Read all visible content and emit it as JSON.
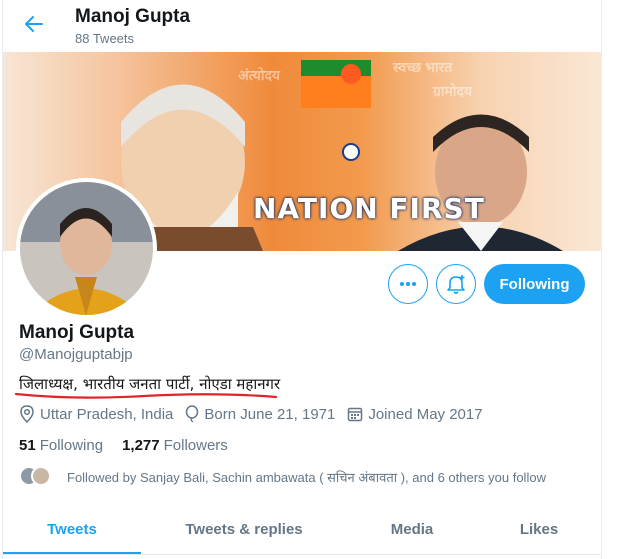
{
  "header": {
    "name": "Manoj Gupta",
    "tweet_count": "88 Tweets"
  },
  "banner": {
    "tagline": "NATION FIRST",
    "watermarks": [
      "अंत्योदय",
      "स्वच्छ भारत",
      "ग्रामोदय"
    ]
  },
  "profile": {
    "name": "Manoj Gupta",
    "handle": "@Manojguptabjp",
    "bio": "जिलाध्यक्ष, भारतीय जनता पार्टी, नोएडा महानगर",
    "location": "Uttar Pradesh, India",
    "born": "Born June 21, 1971",
    "joined": "Joined May 2017",
    "following_count": "51",
    "following_label": "Following",
    "followers_count": "1,277",
    "followers_label": "Followers",
    "followed_by": "Followed by Sanjay Bali, Sachin ambawata ( सचिन अंबावता ), and 6 others you follow"
  },
  "actions": {
    "more_icon": "more-horizontal-icon",
    "notify_icon": "bell-plus-icon",
    "follow_label": "Following"
  },
  "tabs": [
    {
      "label": "Tweets",
      "active": true
    },
    {
      "label": "Tweets & replies",
      "active": false
    },
    {
      "label": "Media",
      "active": false
    },
    {
      "label": "Likes",
      "active": false
    }
  ],
  "colors": {
    "accent": "#1da1f2",
    "muted": "#657786",
    "text": "#14171a",
    "underline": "#e0242c"
  }
}
